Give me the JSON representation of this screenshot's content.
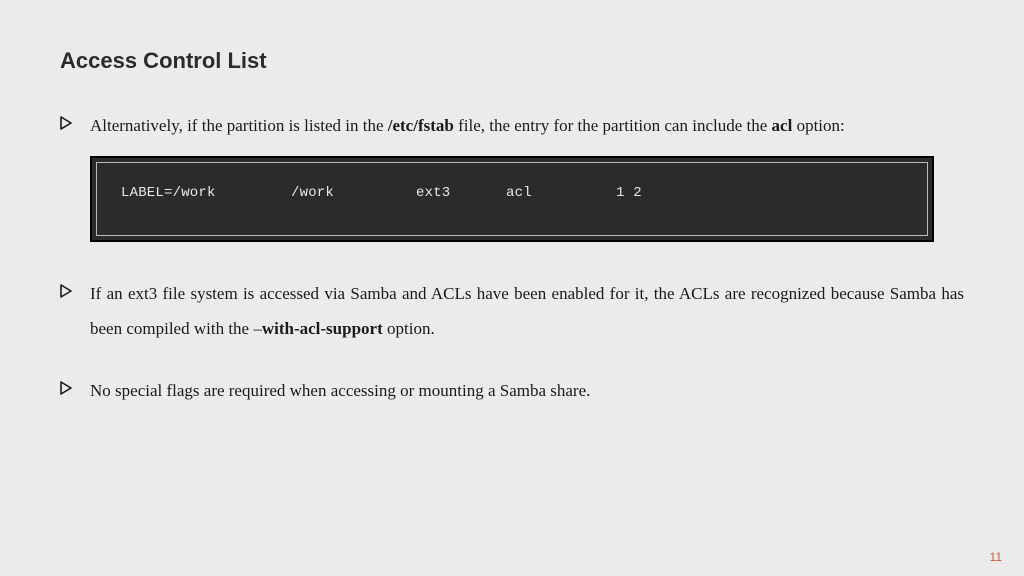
{
  "title": "Access Control List",
  "bullets": {
    "b1": {
      "pre": "Alternatively, if the partition is listed in the ",
      "bold1": "/etc/fstab",
      "mid": " file, the entry for the partition can include the ",
      "bold2": "acl",
      "post": " option:"
    },
    "b2": {
      "pre": "If an ext3 file system is accessed via Samba and ACLs have been enabled for it, the ACLs are recognized because Samba has been compiled with the –",
      "bold1": "with-acl-support",
      "post": " option."
    },
    "b3": {
      "text": "No special flags are required when accessing or mounting a Samba share."
    }
  },
  "code": {
    "c1": "LABEL=/work",
    "c2": "/work",
    "c3": "ext3",
    "c4": "acl",
    "c5": "1 2"
  },
  "page_number": "11"
}
